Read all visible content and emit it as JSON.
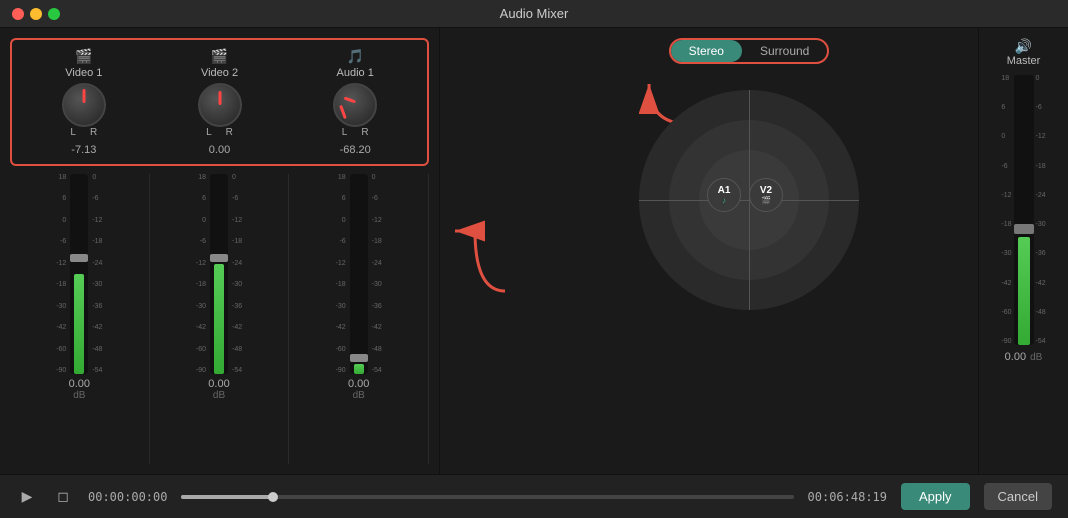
{
  "titlebar": {
    "title": "Audio Mixer",
    "dots": [
      "red",
      "yellow",
      "green"
    ]
  },
  "channels": [
    {
      "icon": "🎬",
      "name": "Video 1",
      "db_value": "-7.13",
      "knob_type": "1",
      "slider_db": "0.00",
      "slider_db_unit": "dB"
    },
    {
      "icon": "🎬",
      "name": "Video 2",
      "db_value": "0.00",
      "knob_type": "2",
      "slider_db": "0.00",
      "slider_db_unit": "dB"
    },
    {
      "icon": "🎵",
      "name": "Audio 1",
      "db_value": "-68.20",
      "knob_type": "3",
      "slider_db": "0.00",
      "slider_db_unit": "dB"
    }
  ],
  "scale_labels": [
    "18",
    "6",
    "0",
    "-6",
    "-12",
    "-18",
    "-30",
    "-42",
    "-60",
    "-90"
  ],
  "scale_labels_right": [
    "0",
    "-6",
    "-12",
    "-18",
    "-24",
    "-30",
    "-36",
    "-42",
    "-48",
    "-54"
  ],
  "stereo_surround": {
    "stereo_label": "Stereo",
    "surround_label": "Surround",
    "active": "stereo"
  },
  "surround_dots": [
    {
      "id": "A1",
      "icon": "♪"
    },
    {
      "id": "V2",
      "icon": "🎬"
    }
  ],
  "master": {
    "icon": "🔊",
    "label": "Master",
    "db_value": "0.00",
    "db_unit": "dB",
    "scale": [
      "18",
      "6",
      "0",
      "-6",
      "-12",
      "-18",
      "-30",
      "-42",
      "-60",
      "-90"
    ]
  },
  "scale_right_master": [
    "0",
    "-6",
    "-12",
    "-18",
    "-24",
    "-30",
    "-36",
    "-42",
    "-48",
    "-54"
  ],
  "toolbar": {
    "play_icon": "▶",
    "stop_icon": "◻",
    "timecode_start": "00:00:00:00",
    "timecode_end": "00:06:48:19",
    "apply_label": "Apply",
    "cancel_label": "Cancel"
  }
}
